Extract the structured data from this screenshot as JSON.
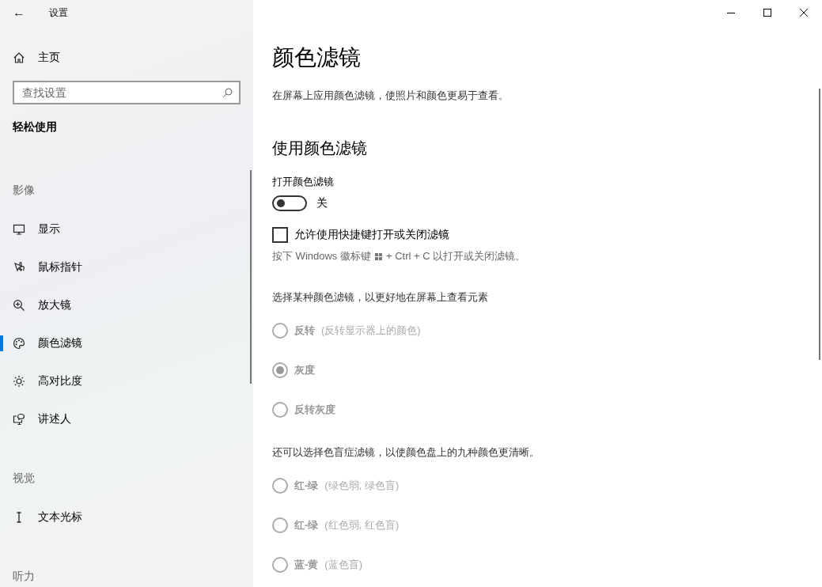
{
  "window": {
    "title": "设置",
    "back_label": "←"
  },
  "sidebar": {
    "home": "主页",
    "search": {
      "placeholder": "查找设置"
    },
    "category": "轻松使用",
    "groups": [
      {
        "heading": "影像",
        "items": [
          {
            "label": "显示",
            "selected": false
          },
          {
            "label": "鼠标指针",
            "selected": false
          },
          {
            "label": "放大镜",
            "selected": false
          },
          {
            "label": "颜色滤镜",
            "selected": true
          },
          {
            "label": "高对比度",
            "selected": false
          },
          {
            "label": "讲述人",
            "selected": false
          }
        ]
      },
      {
        "heading": "视觉",
        "items": [
          {
            "label": "文本光标",
            "selected": false
          }
        ]
      },
      {
        "heading": "听力"
      }
    ]
  },
  "page": {
    "title": "颜色滤镜",
    "description": "在屏幕上应用颜色滤镜，使照片和颜色更易于查看。",
    "section": "使用颜色滤镜",
    "toggle": {
      "label": "打开颜色滤镜",
      "on": false,
      "state_text": "关"
    },
    "shortcut": {
      "label": "允许使用快捷键打开或关闭滤镜",
      "checked": false
    },
    "hint_before": "按下 Windows 徽标键",
    "hint_after": "+ Ctrl + C 以打开或关闭滤镜。",
    "filter_groups": [
      {
        "intro": "选择某种颜色滤镜，以更好地在屏幕上查看元素",
        "disabled": true,
        "options": [
          {
            "name": "反转",
            "detail": "(反转显示器上的颜色)",
            "selected": false
          },
          {
            "name": "灰度",
            "selected": true
          },
          {
            "name": "反转灰度",
            "selected": false
          }
        ]
      },
      {
        "intro": "还可以选择色盲症滤镜，以使颜色盘上的九种颜色更清晰。",
        "disabled": true,
        "options": [
          {
            "name": "红-绿",
            "detail": "(绿色弱, 绿色盲)",
            "selected": false
          },
          {
            "name": "红-绿",
            "detail": "(红色弱, 红色盲)",
            "selected": false
          },
          {
            "name": "蓝-黄",
            "detail": "(蓝色盲)",
            "selected": false
          }
        ]
      }
    ]
  }
}
